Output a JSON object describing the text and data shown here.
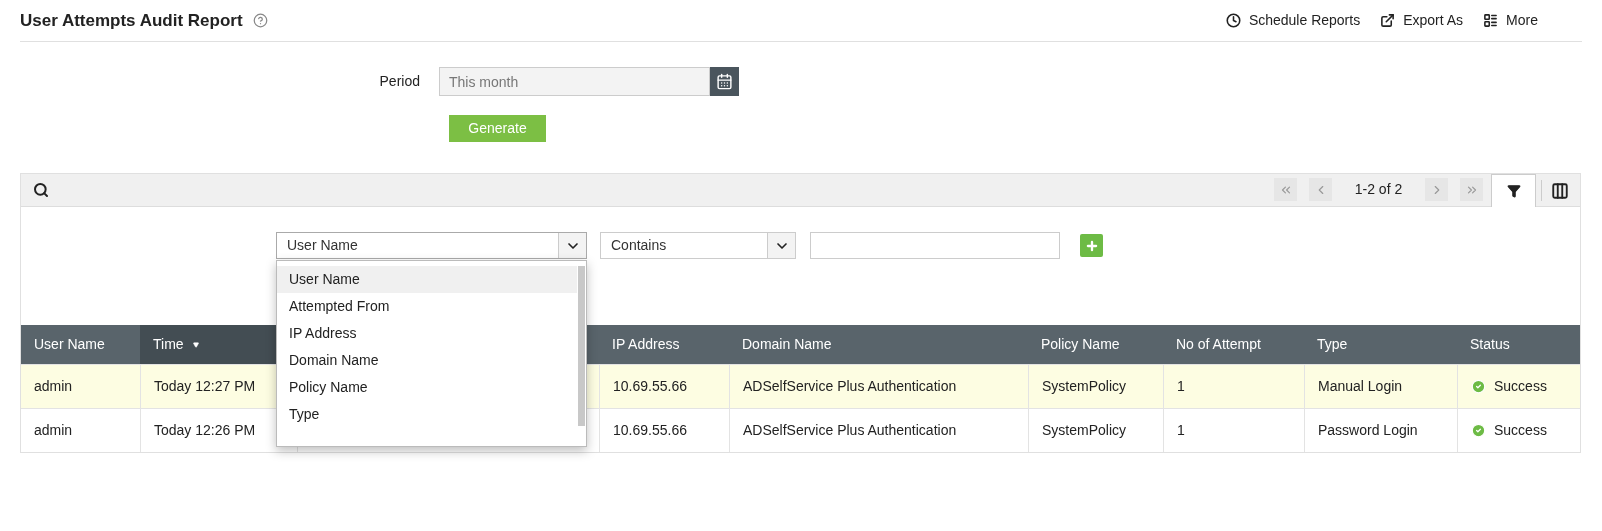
{
  "header": {
    "title": "User Attempts Audit Report",
    "actions": [
      {
        "kind": "schedule",
        "label": "Schedule Reports"
      },
      {
        "kind": "export",
        "label": "Export As"
      },
      {
        "kind": "more",
        "label": "More"
      }
    ]
  },
  "period": {
    "label": "Period",
    "value": "This month"
  },
  "generate_button": "Generate",
  "toolbar": {
    "page_info": "1-2 of 2",
    "filter_tab_selected": true
  },
  "filter": {
    "field": "User Name",
    "operator": "Contains",
    "options": [
      {
        "label": "User Name",
        "selected": true
      },
      {
        "label": "Attempted From",
        "selected": false
      },
      {
        "label": "IP Address",
        "selected": false
      },
      {
        "label": "Domain Name",
        "selected": false
      },
      {
        "label": "Policy Name",
        "selected": false
      },
      {
        "label": "Type",
        "selected": false
      }
    ]
  },
  "table": {
    "columns": [
      {
        "label": "User Name",
        "sorted": false
      },
      {
        "label": "Time",
        "sorted": true
      },
      {
        "label": "IP Address",
        "sorted": false
      },
      {
        "label": "Domain Name",
        "sorted": false
      },
      {
        "label": "Policy Name",
        "sorted": false
      },
      {
        "label": "No of Attempt",
        "sorted": false
      },
      {
        "label": "Type",
        "sorted": false
      },
      {
        "label": "Status",
        "sorted": false
      }
    ],
    "rows": [
      {
        "highlighted": true,
        "cells": [
          "admin",
          "Today 12:27 PM",
          "10.69.55.66",
          "ADSelfService Plus Authentication",
          "SystemPolicy",
          "1",
          "Manual Login",
          "Success"
        ]
      },
      {
        "highlighted": false,
        "cells": [
          "admin",
          "Today 12:26 PM",
          "10.69.55.66",
          "ADSelfService Plus Authentication",
          "SystemPolicy",
          "1",
          "Password Login",
          "Success"
        ]
      }
    ]
  }
}
